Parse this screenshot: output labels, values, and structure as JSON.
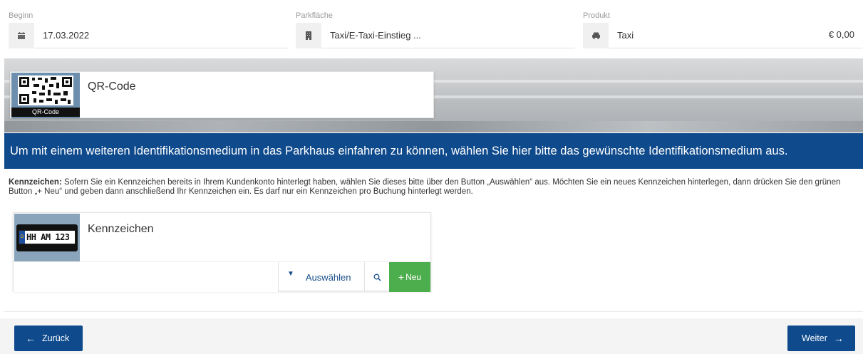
{
  "summary": {
    "begin_label": "Beginn",
    "begin_value": "17.03.2022",
    "begin_icon": "calendar-icon",
    "parking_label": "Parkfläche",
    "parking_value": "Taxi/E-Taxi-Einstieg ...",
    "parking_icon": "building-icon",
    "product_label": "Produkt",
    "product_value": "Taxi",
    "product_icon": "car-icon",
    "price": "€ 0,00"
  },
  "qr": {
    "title": "QR-Code",
    "thumb_label": "QR-Code"
  },
  "banner": {
    "text": "Um mit einem weiteren Identifikationsmedium in das Parkhaus einfahren zu können, wählen Sie hier bitte das gewünschte Identifikationsmedium aus."
  },
  "description": {
    "bold": "Kennzeichen:",
    "text": " Sofern Sie ein Kennzeichen bereits in Ihrem Kundenkonto hinterlegt haben, wählen Sie dieses bitte über den Button „Auswählen“ aus. Möchten Sie ein neues Kennzeichen hinterlegen, dann drücken Sie den grünen Button „+ Neu“ und geben dann anschließend Ihr Kennzeichen ein. Es darf nur ein Kennzeichen pro Buchung hinterlegt werden."
  },
  "plate": {
    "title": "Kennzeichen",
    "sample": "HH AM 123",
    "eu_mark": "D",
    "input_value": "",
    "select_label": "Auswählen",
    "new_label": "Neu"
  },
  "footer": {
    "back_label": "Zurück",
    "next_label": "Weiter"
  },
  "colors": {
    "brand_blue": "#0f4a8c",
    "success_green": "#4cae4c"
  }
}
